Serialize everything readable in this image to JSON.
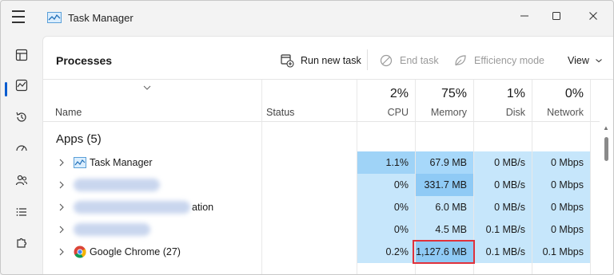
{
  "window": {
    "title": "Task Manager"
  },
  "toolbar": {
    "page_title": "Processes",
    "run_new_task": "Run new task",
    "end_task": "End task",
    "efficiency_mode": "Efficiency mode",
    "view": "View"
  },
  "columns": {
    "name": "Name",
    "status": "Status",
    "cpu": {
      "pct": "2%",
      "label": "CPU"
    },
    "memory": {
      "pct": "75%",
      "label": "Memory"
    },
    "disk": {
      "pct": "1%",
      "label": "Disk"
    },
    "network": {
      "pct": "0%",
      "label": "Network"
    }
  },
  "group": {
    "title": "Apps (5)"
  },
  "rows": [
    {
      "name": "Task Manager",
      "name_visible": true,
      "icon": "task-manager-icon",
      "cpu": "1.1%",
      "memory": "67.9 MB",
      "disk": "0 MB/s",
      "network": "0 Mbps",
      "cpu_color": "#9fd3f7",
      "mem_color": "#a7d8fa"
    },
    {
      "name": "",
      "name_visible": false,
      "icon": "blurred-app-icon",
      "cpu": "0%",
      "memory": "331.7 MB",
      "disk": "0 MB/s",
      "network": "0 Mbps",
      "cpu_color": "#c6e6fb",
      "mem_color": "#8fcaf5"
    },
    {
      "name": "ation",
      "name_visible": false,
      "icon": "blurred-app-icon",
      "cpu": "0%",
      "memory": "6.0 MB",
      "disk": "0 MB/s",
      "network": "0 Mbps",
      "cpu_color": "#c6e6fb",
      "mem_color": "#c6e6fb"
    },
    {
      "name": "",
      "name_visible": false,
      "icon": "blurred-app-icon",
      "cpu": "0%",
      "memory": "4.5 MB",
      "disk": "0.1 MB/s",
      "network": "0 Mbps",
      "cpu_color": "#c6e6fb",
      "mem_color": "#c6e6fb"
    },
    {
      "name": "Google Chrome (27)",
      "name_visible": true,
      "icon": "chrome-icon",
      "cpu": "0.2%",
      "memory": "1,127.6 MB",
      "disk": "0.1 MB/s",
      "network": "0.1 Mbps",
      "cpu_color": "#c6e6fb",
      "mem_color": "#8fcaf5"
    }
  ],
  "colors": {
    "accent": "#0a5ccf",
    "highlight_border": "#e0313b",
    "heat_light": "#c6e6fb",
    "heat_mid": "#a7d8fa",
    "heat_strong": "#8fcaf5"
  }
}
